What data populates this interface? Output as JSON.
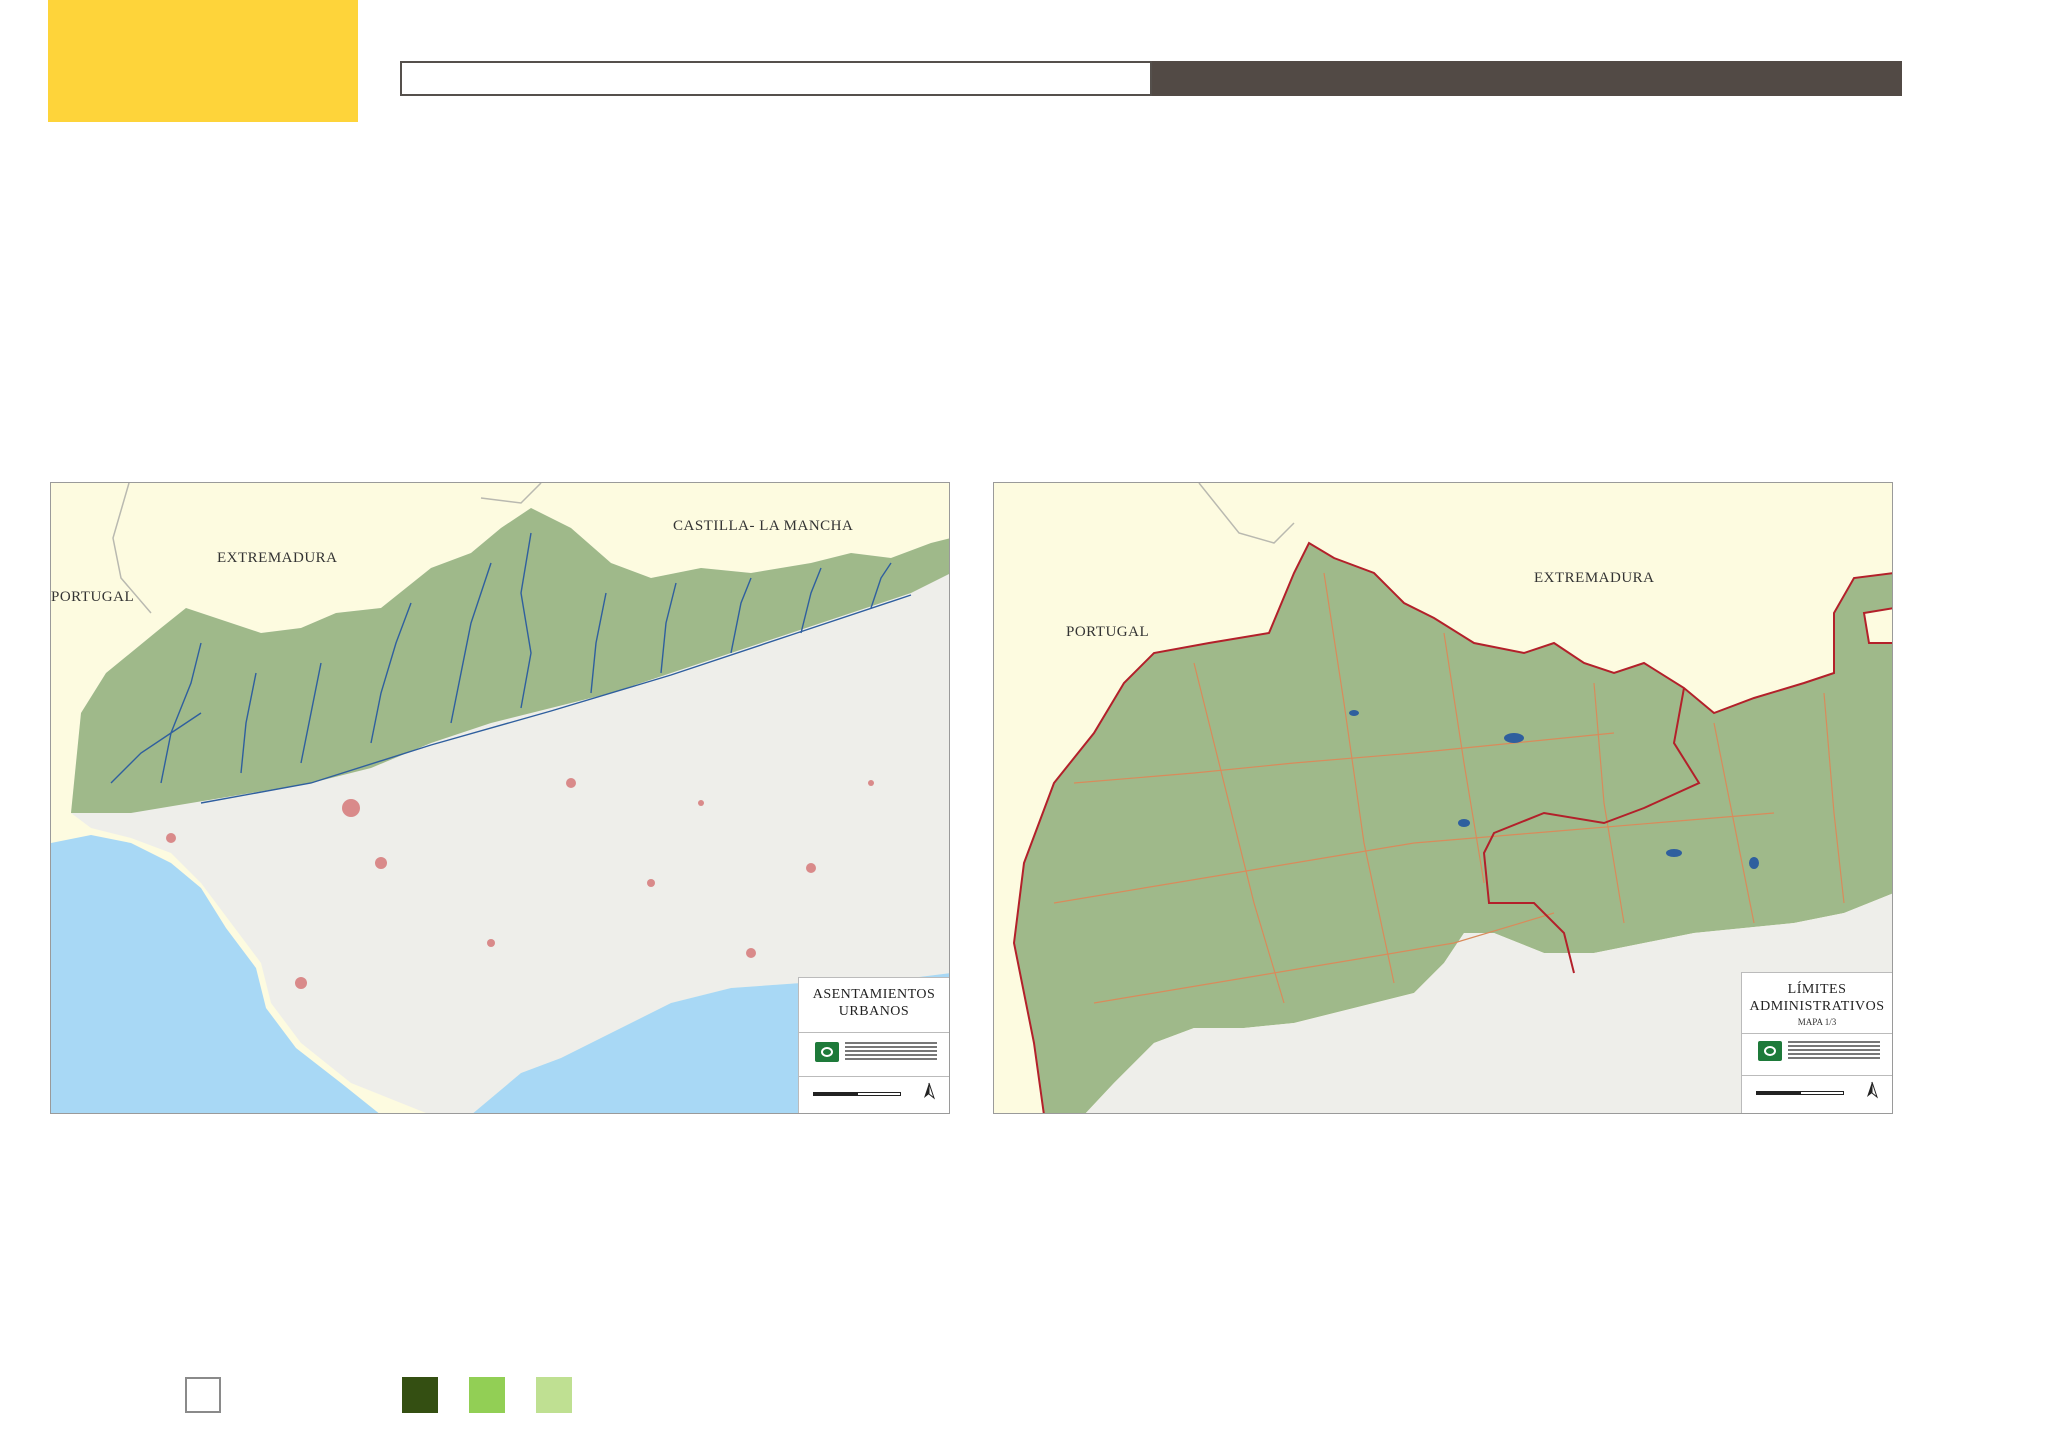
{
  "colors": {
    "accent_yellow": "#fed43a",
    "bar_dark": "#524a45",
    "sea": "#a8d8f5",
    "neighbor_land": "#fdfbe0",
    "highland_green": "#9fb98a",
    "lowland": "#eeeeea",
    "urban": "#d98a8a",
    "river": "#2f5f9e",
    "admin_border": "#b3202a",
    "road": "#d98b5b"
  },
  "map_left": {
    "label_portugal": "PORTUGAL",
    "label_extremadura": "EXTREMADURA",
    "label_castilla": "CASTILLA- LA MANCHA",
    "legend_title_line1": "ASENTAMIENTOS",
    "legend_title_line2": "URBANOS"
  },
  "map_right": {
    "label_portugal": "PORTUGAL",
    "label_extremadura": "EXTREMADURA",
    "legend_title_line1": "LÍMITES",
    "legend_title_line2": "ADMINISTRATIVOS",
    "legend_subtitle": "MAPA 1/3"
  },
  "legend_swatches": [
    {
      "id": "empty",
      "color": "#ffffff",
      "border": "#8a8a8a"
    },
    {
      "id": "dark-green",
      "color": "#344f12",
      "border": "#344f12"
    },
    {
      "id": "medium-green",
      "color": "#92cf55",
      "border": "#92cf55"
    },
    {
      "id": "light-green",
      "color": "#bfe092",
      "border": "#bfe092"
    }
  ]
}
